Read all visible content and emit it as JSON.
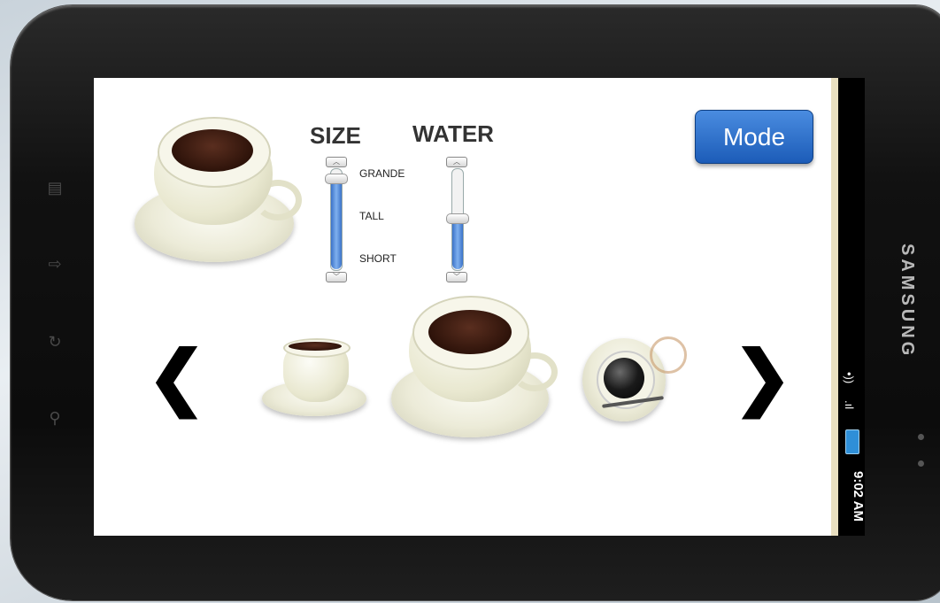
{
  "controls": {
    "size_label": "SIZE",
    "water_label": "WATER",
    "size_options": [
      "GRANDE",
      "TALL",
      "SHORT"
    ],
    "size_selected": "GRANDE",
    "water_level_fraction": 0.53
  },
  "mode_button": {
    "label": "Mode"
  },
  "carousel": {
    "prev_glyph": "❮",
    "next_glyph": "❯"
  },
  "status_bar": {
    "time": "9:02 AM"
  },
  "icons": {
    "hw_menu": "menu-icon",
    "hw_back": "back-icon",
    "hw_home": "home-icon",
    "hw_search": "search-icon",
    "wifi": "wifi-icon",
    "signal": "signal-icon",
    "battery": "battery-icon"
  },
  "colors": {
    "accent": "#2a6fd0",
    "slider_fill": "#4b83d6",
    "coffee": "#2e130a"
  }
}
